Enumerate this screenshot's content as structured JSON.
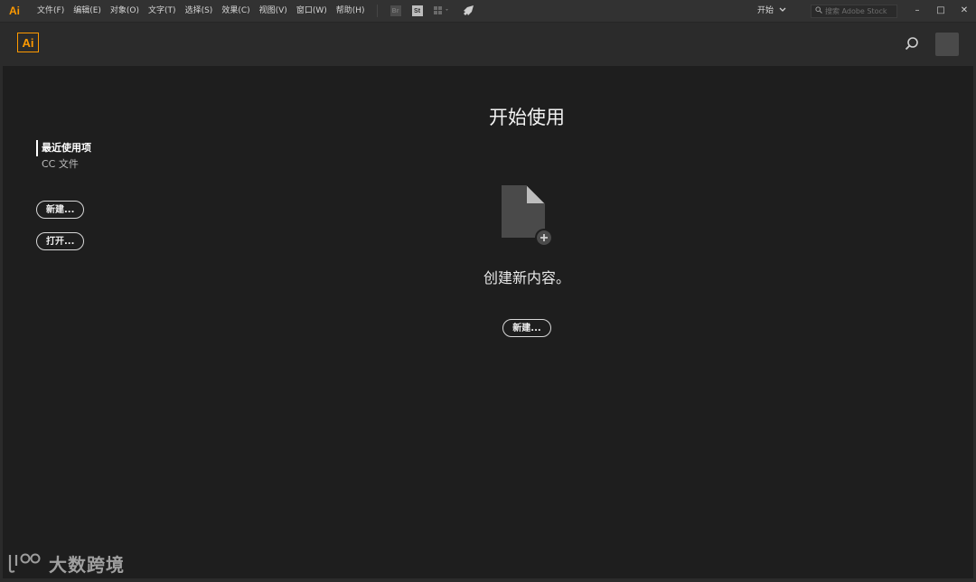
{
  "menubar": {
    "app_icon": "Ai",
    "items": [
      "文件(F)",
      "编辑(E)",
      "对象(O)",
      "文字(T)",
      "选择(S)",
      "效果(C)",
      "视图(V)",
      "窗口(W)",
      "帮助(H)"
    ],
    "tools": {
      "bridge": "Br",
      "stock": "St",
      "arrange_icon": "arrange-documents-icon",
      "rocket_icon": "rocket-icon"
    },
    "workspace_label": "开始",
    "stock_search_placeholder": "搜索 Adobe Stock",
    "window_controls": {
      "minimize": "–",
      "maximize": "□",
      "close": "✕"
    }
  },
  "header": {
    "logo": "Ai",
    "search_icon": "search-icon",
    "avatar_icon": "user-avatar-icon"
  },
  "left_panel": {
    "nav": [
      "最近使用项",
      "CC 文件"
    ],
    "new_button": "新建...",
    "open_button": "打开..."
  },
  "main": {
    "title": "开始使用",
    "empty_icon": "new-document-icon",
    "create_text": "创建新内容。",
    "new_button": "新建..."
  },
  "watermark": {
    "text": "大数跨境"
  },
  "colors": {
    "accent": "#ff9a00",
    "background": "#1e1e1e",
    "header": "#2b2b2b",
    "menubar": "#323232"
  }
}
